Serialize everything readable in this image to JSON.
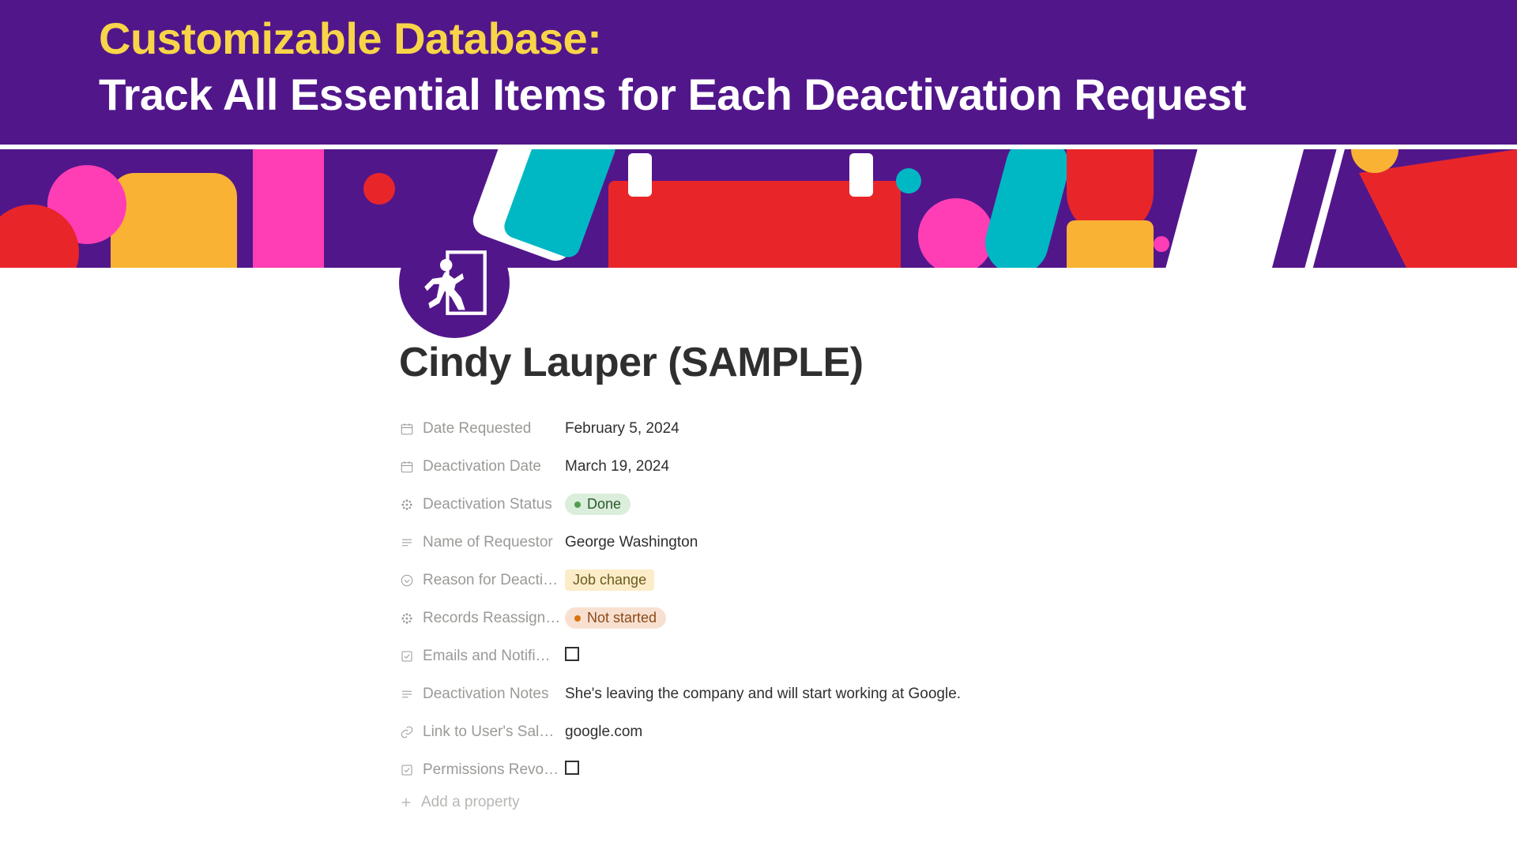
{
  "hero": {
    "title": "Customizable Database:",
    "subtitle": "Track All Essential Items for Each Deactivation Request"
  },
  "page": {
    "title": "Cindy Lauper (SAMPLE)"
  },
  "props": {
    "date_requested": {
      "label": "Date Requested",
      "value": "February 5, 2024"
    },
    "deactivation_date": {
      "label": "Deactivation Date",
      "value": "March 19, 2024"
    },
    "deactivation_status": {
      "label": "Deactivation Status",
      "value": "Done"
    },
    "name_of_requestor": {
      "label": "Name of Requestor",
      "value": "George Washington"
    },
    "reason": {
      "label": "Reason for Deacti…",
      "value": "Job change"
    },
    "records_reassigned": {
      "label": "Records Reassign…",
      "value": "Not started"
    },
    "emails_notifs": {
      "label": "Emails and Notifi…"
    },
    "deactivation_notes": {
      "label": "Deactivation Notes",
      "value": "She's leaving the company and will start working at Google."
    },
    "link_sal": {
      "label": "Link to User's Sal…",
      "value": "google.com"
    },
    "permissions_revoked": {
      "label": "Permissions Revo…"
    },
    "add_property": "Add a property"
  }
}
